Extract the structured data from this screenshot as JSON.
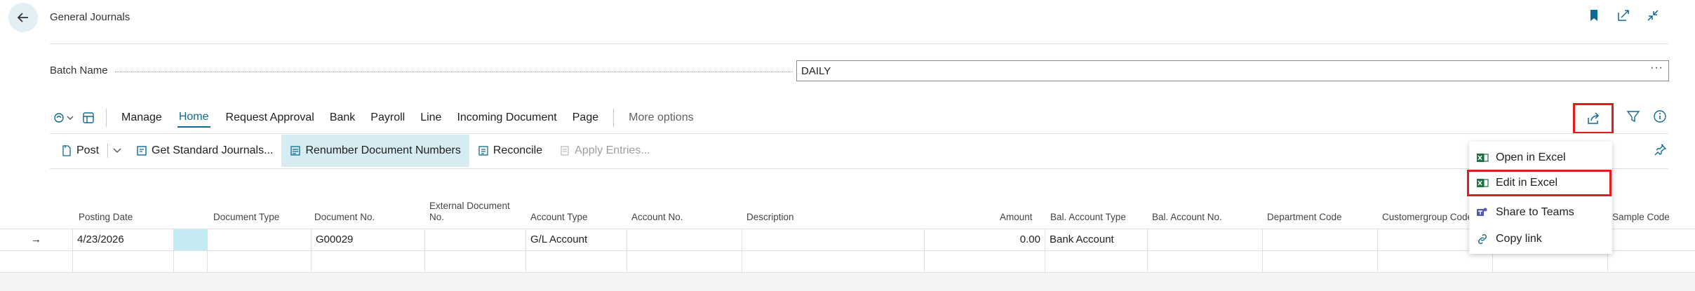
{
  "page": {
    "title": "General Journals"
  },
  "batch": {
    "label": "Batch Name",
    "value": "DAILY",
    "more": "···"
  },
  "actionbar": {
    "items": [
      "Manage",
      "Home",
      "Request Approval",
      "Bank",
      "Payroll",
      "Line",
      "Incoming Document",
      "Page"
    ],
    "more_options": "More options"
  },
  "subbar": {
    "post": "Post",
    "get_standard": "Get Standard Journals...",
    "renumber": "Renumber Document Numbers",
    "reconcile": "Reconcile",
    "apply_entries": "Apply Entries..."
  },
  "grid": {
    "columns": {
      "posting_date": "Posting Date",
      "document_type": "Document Type",
      "document_no": "Document No.",
      "external_doc_1": "External Document",
      "external_doc_2": "No.",
      "account_type": "Account Type",
      "account_no": "Account No.",
      "description": "Description",
      "amount": "Amount",
      "bal_account_type": "Bal. Account Type",
      "bal_account_no": "Bal. Account No.",
      "department_code": "Department Code",
      "customergroup_code": "Customergroup Code",
      "sample_code": "Sample Code"
    },
    "row1": {
      "arrow": "→",
      "posting_date": "4/23/2026",
      "document_no": "G00029",
      "account_type": "G/L Account",
      "amount": "0.00",
      "bal_account_type": "Bank Account"
    }
  },
  "share_menu": {
    "open_in_excel": "Open in Excel",
    "edit_in_excel": "Edit in Excel",
    "share_to_teams": "Share to Teams",
    "copy_link": "Copy link"
  },
  "colors": {
    "accent": "#0e6a91",
    "highlight_box": "#e21b1b",
    "excel_green": "#1e7145",
    "teams_purple": "#5558af"
  }
}
